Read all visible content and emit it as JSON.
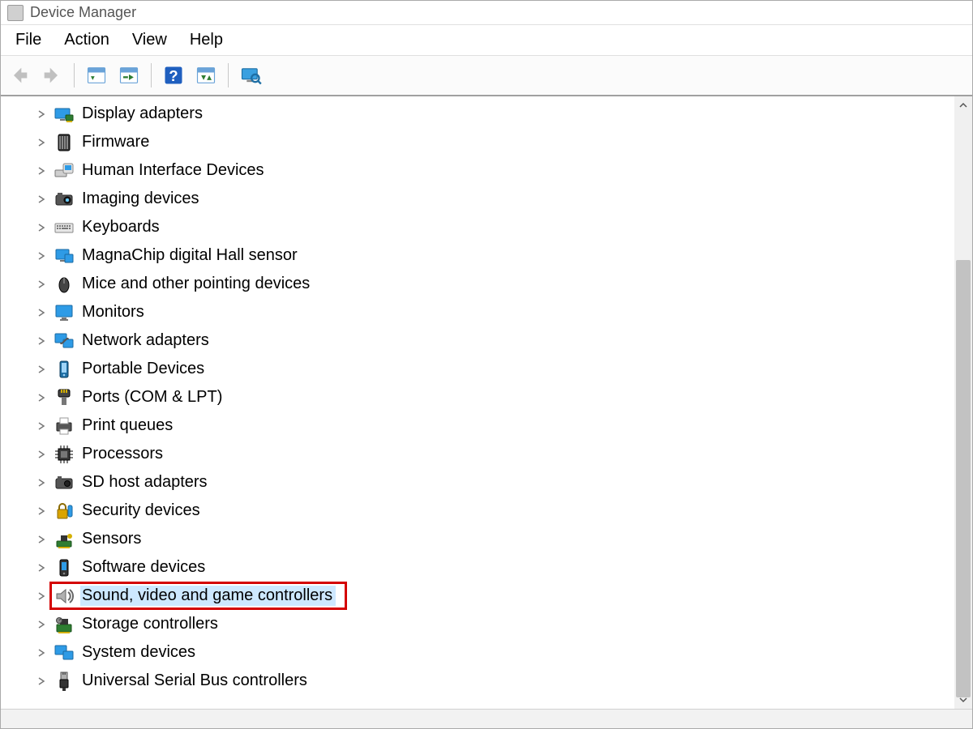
{
  "window": {
    "title": "Device Manager"
  },
  "menu": {
    "items": [
      "File",
      "Action",
      "View",
      "Help"
    ]
  },
  "toolbar": {
    "back": {
      "name": "back-button",
      "enabled": false
    },
    "fwd": {
      "name": "forward-button",
      "enabled": false
    },
    "sep1": true,
    "props": {
      "name": "properties-button"
    },
    "scan": {
      "name": "scan-hardware-button"
    },
    "sep2": true,
    "help": {
      "name": "help-button"
    },
    "update": {
      "name": "update-driver-button"
    },
    "sep3": true,
    "show": {
      "name": "show-hidden-devices-button"
    }
  },
  "tree": {
    "items": [
      {
        "label": "Display adapters",
        "icon": "display-adapter-icon"
      },
      {
        "label": "Firmware",
        "icon": "firmware-icon"
      },
      {
        "label": "Human Interface Devices",
        "icon": "hid-icon"
      },
      {
        "label": "Imaging devices",
        "icon": "imaging-device-icon"
      },
      {
        "label": "Keyboards",
        "icon": "keyboard-icon"
      },
      {
        "label": "MagnaChip digital Hall sensor",
        "icon": "sensor-chip-icon"
      },
      {
        "label": "Mice and other pointing devices",
        "icon": "mouse-icon"
      },
      {
        "label": "Monitors",
        "icon": "monitor-icon"
      },
      {
        "label": "Network adapters",
        "icon": "network-adapter-icon"
      },
      {
        "label": "Portable Devices",
        "icon": "portable-device-icon"
      },
      {
        "label": "Ports (COM & LPT)",
        "icon": "ports-icon"
      },
      {
        "label": "Print queues",
        "icon": "printer-icon"
      },
      {
        "label": "Processors",
        "icon": "processor-icon"
      },
      {
        "label": "SD host adapters",
        "icon": "sd-host-icon"
      },
      {
        "label": "Security devices",
        "icon": "security-device-icon"
      },
      {
        "label": "Sensors",
        "icon": "sensors-icon"
      },
      {
        "label": "Software devices",
        "icon": "software-device-icon"
      },
      {
        "label": "Sound, video and game controllers",
        "icon": "sound-video-game-icon",
        "selected": true,
        "highlighted": true
      },
      {
        "label": "Storage controllers",
        "icon": "storage-controller-icon"
      },
      {
        "label": "System devices",
        "icon": "system-device-icon"
      },
      {
        "label": "Universal Serial Bus controllers",
        "icon": "usb-controller-icon"
      }
    ]
  }
}
